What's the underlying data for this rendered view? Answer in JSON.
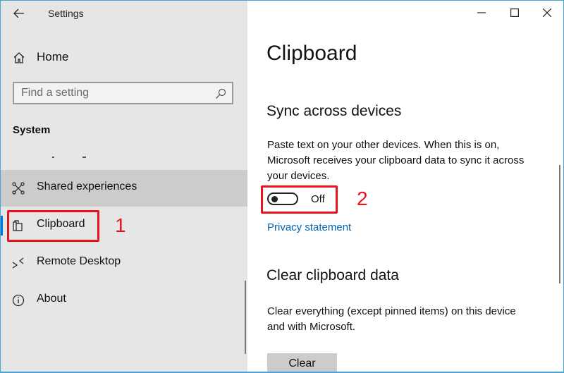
{
  "window": {
    "app_title": "Settings",
    "controls": {
      "minimize": "minimize-icon",
      "maximize": "maximize-icon",
      "close": "close-icon"
    }
  },
  "sidebar": {
    "back_icon": "arrow-left-icon",
    "home": {
      "label": "Home",
      "icon": "home-icon"
    },
    "search": {
      "placeholder": "Find a setting",
      "value": "",
      "icon": "search-icon"
    },
    "section_title": "System",
    "items": [
      {
        "label": "Shared experiences",
        "icon": "shared-experiences-icon",
        "state": "hover"
      },
      {
        "label": "Clipboard",
        "icon": "clipboard-icon",
        "state": "selected"
      },
      {
        "label": "Remote Desktop",
        "icon": "remote-desktop-icon",
        "state": "normal"
      },
      {
        "label": "About",
        "icon": "info-icon",
        "state": "normal"
      }
    ]
  },
  "content": {
    "page_title": "Clipboard",
    "sync": {
      "heading": "Sync across devices",
      "description": "Paste text on your other devices. When this is on, Microsoft receives your clipboard data to sync it across your devices.",
      "toggle_state": "Off",
      "toggle_on": false,
      "privacy_link": "Privacy statement"
    },
    "clear": {
      "heading": "Clear clipboard data",
      "description": "Clear everything (except pinned items) on this device and with Microsoft.",
      "button_label": "Clear"
    }
  },
  "annotations": [
    {
      "number": "1",
      "target": "Clipboard sidebar item"
    },
    {
      "number": "2",
      "target": "Sync toggle"
    }
  ],
  "colors": {
    "accent": "#0078d7",
    "link": "#0063b1",
    "annotation": "#e8141c",
    "sidebar_bg": "#e6e6e6",
    "hover_bg": "#cccccc"
  }
}
